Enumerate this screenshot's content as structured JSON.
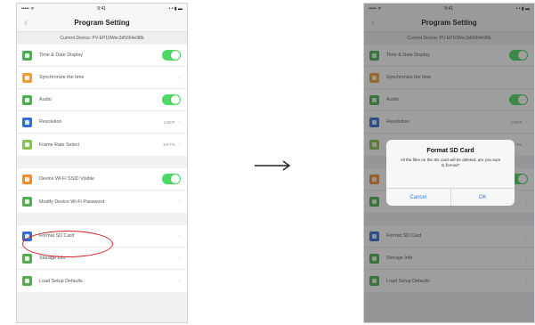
{
  "status_bar": {
    "carrier": "••••• ᯤ",
    "time": "9:41",
    "battery": "• • ▮ ▬"
  },
  "header": {
    "back_icon": "chevron-left-icon",
    "title": "Program Setting"
  },
  "device_line": "Current Device: PV-EP10Wec3d5664e98b",
  "groups": [
    [
      {
        "id": "time-date-display",
        "label": "Time & Date Display",
        "icon_color": "#4caf50",
        "control": "toggle",
        "on": true
      },
      {
        "id": "synchronize-time",
        "label": "Synchronize the time",
        "icon_color": "#f0a030",
        "control": "chevron"
      },
      {
        "id": "audio",
        "label": "Audio",
        "icon_color": "#4caf50",
        "control": "toggle",
        "on": true
      },
      {
        "id": "resolution",
        "label": "Resolution",
        "icon_color": "#2f6fd4",
        "control": "value",
        "value": "1080P"
      },
      {
        "id": "frame-rate",
        "label": "Frame Rate Select",
        "icon_color": "#8bc34a",
        "control": "value",
        "value": "30FPS"
      }
    ],
    [
      {
        "id": "wifi-ssid-visible",
        "label": "Device Wi-Fi SSID Visible",
        "icon_color": "#f28c28",
        "control": "toggle",
        "on": true
      },
      {
        "id": "modify-wifi-password",
        "label": "Modify Device Wi-Fi Password",
        "icon_color": "#4caf50",
        "control": "chevron"
      }
    ],
    [
      {
        "id": "format-sd-card",
        "label": "Format SD Card",
        "icon_color": "#2f6fd4",
        "control": "chevron"
      },
      {
        "id": "storage-info",
        "label": "Storage Info",
        "icon_color": "#4caf50",
        "control": "chevron"
      },
      {
        "id": "load-setup-defaults",
        "label": "Load Setup Defaults",
        "icon_color": "#4caf50",
        "control": "chevron"
      }
    ]
  ],
  "dialog": {
    "title": "Format SD Card",
    "message": "All the files on the SD card will be deleted, are you sure to format?",
    "cancel_label": "Cancel",
    "ok_label": "OK"
  },
  "colors": {
    "highlight": "#d2232a",
    "toggle_on": "#4cd964",
    "link": "#2a7ae2"
  },
  "arrow_icon": "right-arrow-icon"
}
